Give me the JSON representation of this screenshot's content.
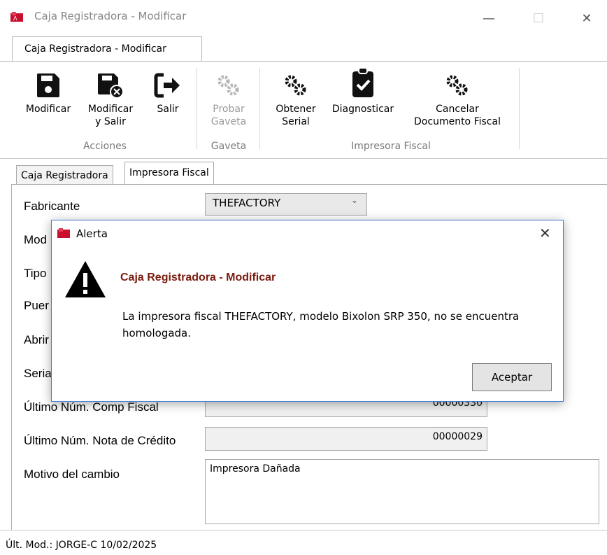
{
  "window": {
    "title": "Caja Registradora - Modificar"
  },
  "ribbon": {
    "tab": "Caja Registradora - Modificar",
    "buttons": {
      "modificar": "Modificar",
      "modificar_salir_1": "Modificar",
      "modificar_salir_2": "y Salir",
      "salir": "Salir",
      "probar_1": "Probar",
      "probar_2": "Gaveta",
      "obtener_1": "Obtener",
      "obtener_2": "Serial",
      "diagnosticar": "Diagnosticar",
      "cancelar_1": "Cancelar",
      "cancelar_2": "Documento Fiscal"
    },
    "groups": {
      "acciones": "Acciones",
      "gaveta": "Gaveta",
      "impresora": "Impresora Fiscal"
    }
  },
  "tabs": {
    "caja": "Caja Registradora",
    "impresora": "Impresora Fiscal"
  },
  "form": {
    "fabricante_label": "Fabricante",
    "fabricante_value": "THEFACTORY",
    "modelo_label": "Mod",
    "tipo_label": "Tipo",
    "puerto_label": "Puer",
    "abrir_label": "Abrir",
    "serial_label": "Seria",
    "ultimo_comp_label": "Último Núm. Comp Fiscal",
    "ultimo_comp_value": "00000330",
    "ultimo_nota_label": "Último Núm. Nota de Crédito",
    "ultimo_nota_value": "00000029",
    "motivo_label": "Motivo del cambio",
    "motivo_value": "Impresora Dañada"
  },
  "status": {
    "text": "Últ. Mod.:  JORGE-C  10/02/2025"
  },
  "dialog": {
    "title": "Alerta",
    "heading": "Caja Registradora - Modificar",
    "message_1": "La impresora fiscal THEFACTORY, modelo Bixolon SRP 350, no se encuentra",
    "message_2": "homologada.",
    "ok": "Aceptar"
  }
}
